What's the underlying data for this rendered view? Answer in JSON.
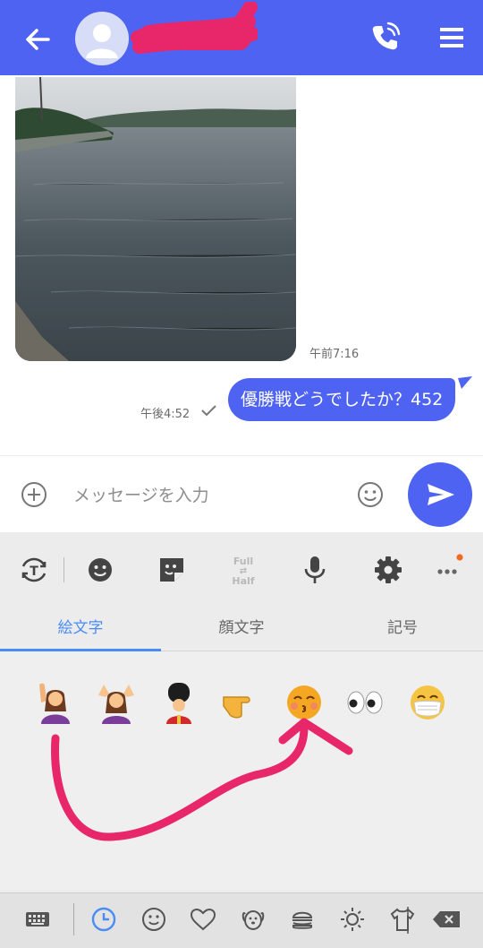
{
  "header": {
    "contact_name": ""
  },
  "chat": {
    "messages": [
      {
        "type": "image",
        "time": "午前7:16"
      },
      {
        "type": "text",
        "text": "優勝戦どうでしたか？452",
        "time": "午後4:52",
        "status": "read-check"
      }
    ]
  },
  "composer": {
    "placeholder": "メッセージを入力"
  },
  "keyboard": {
    "toolbar_half": {
      "line1": "Full",
      "line2": "Half"
    },
    "tabs": [
      {
        "label": "絵文字",
        "active": true
      },
      {
        "label": "顔文字",
        "active": false
      },
      {
        "label": "記号",
        "active": false
      }
    ],
    "emoji_row": [
      "🙋‍♀️",
      "🙆‍♀️",
      "💂",
      "👉",
      "😚",
      "👀",
      "😷"
    ],
    "bottom_categories": [
      "keyboard-icon",
      "clock-icon",
      "smiley-icon",
      "heart-icon",
      "dog-icon",
      "burger-icon",
      "sun-icon",
      "shirt-icon",
      "backspace-icon"
    ]
  },
  "colors": {
    "accent": "#4f63f2",
    "annotation": "#e8266a",
    "tab_active": "#4a8cf7"
  }
}
